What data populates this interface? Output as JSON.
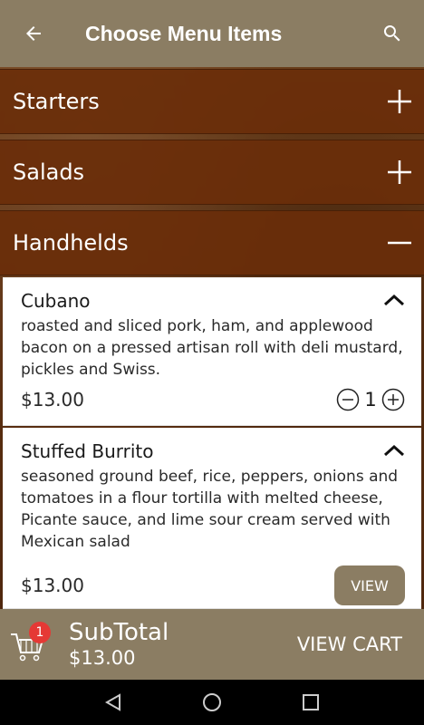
{
  "app_bar": {
    "title": "Choose Menu Items",
    "back_icon": "arrow-left-icon",
    "search_icon": "search-icon"
  },
  "categories": [
    {
      "label": "Starters",
      "expanded": false,
      "toggle_icon": "plus-icon"
    },
    {
      "label": "Salads",
      "expanded": false,
      "toggle_icon": "plus-icon"
    },
    {
      "label": "Handhelds",
      "expanded": true,
      "toggle_icon": "minus-icon"
    }
  ],
  "items": [
    {
      "name": "Cubano",
      "description": "roasted and sliced pork, ham, and applewood bacon on a pressed artisan roll with deli mustard, pickles and Swiss.",
      "price": "$13.00",
      "quantity": "1",
      "collapse_icon": "chevron-up-icon"
    },
    {
      "name": "Stuffed Burrito",
      "description": "seasoned ground beef, rice, peppers, onions and tomatoes in a flour tortilla with melted cheese, Picante sauce, and lime sour cream served with Mexican salad",
      "price": "$13.00",
      "view_label": "VIEW",
      "collapse_icon": "chevron-up-icon"
    }
  ],
  "cart": {
    "badge_count": "1",
    "subtotal_label": "SubTotal",
    "subtotal_amount": "$13.00",
    "view_cart_label": "VIEW CART"
  },
  "colors": {
    "app_bar": "#8b7d63",
    "category_bg": "#6a2e0a",
    "badge": "#e53935"
  }
}
